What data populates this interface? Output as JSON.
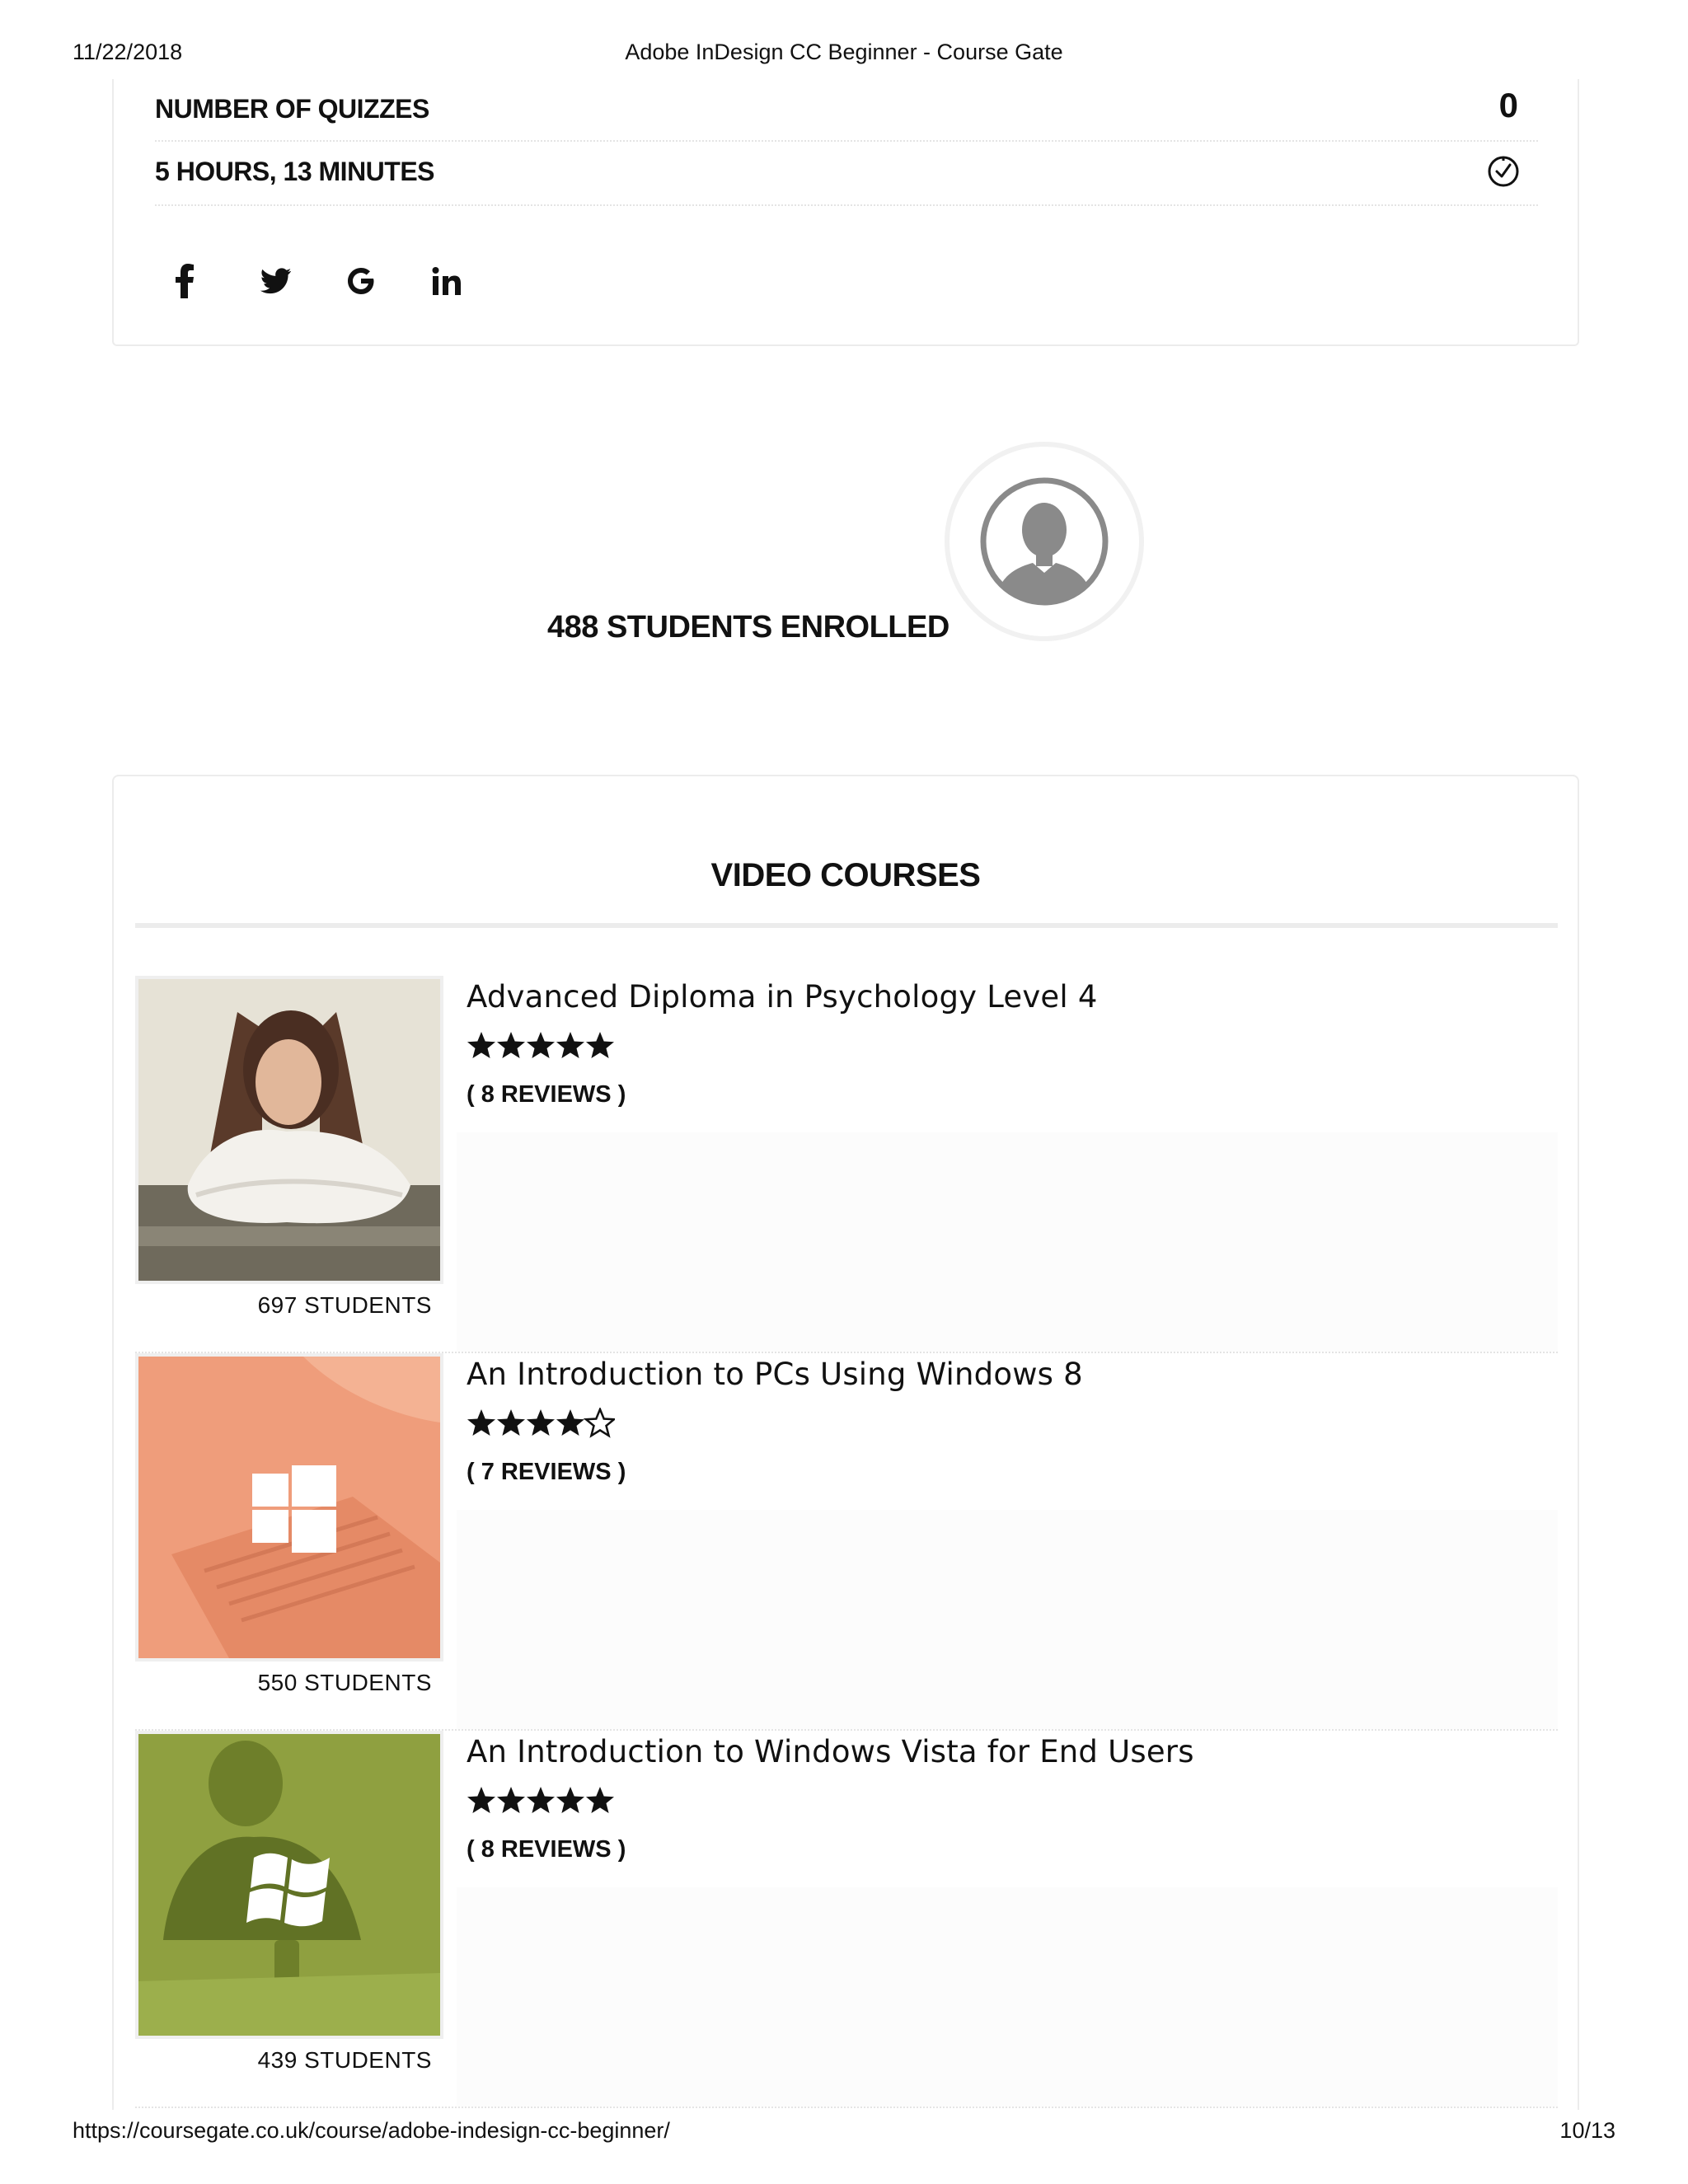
{
  "print_header": {
    "date": "11/22/2018",
    "title": "Adobe InDesign CC Beginner - Course Gate"
  },
  "print_footer": {
    "url": "https://coursegate.co.uk/course/adobe-indesign-cc-beginner/",
    "page": "10/13"
  },
  "meta": {
    "quizzes_label": "NUMBER OF QUIZZES",
    "quizzes_value": "0",
    "duration_label": "5 HOURS, 13 MINUTES",
    "duration_icon": "clock-check-icon",
    "social_icons": [
      "facebook-icon",
      "twitter-icon",
      "google-icon",
      "linkedin-icon"
    ]
  },
  "enrolled": {
    "text": "488 STUDENTS ENROLLED",
    "icon": "user-avatar-icon"
  },
  "video_courses": {
    "title": "VIDEO COURSES",
    "items": [
      {
        "name": "Advanced Diploma in Psychology Level 4",
        "rating": 5,
        "reviews": "( 8 REVIEWS )",
        "students": "697 STUDENTS",
        "thumb_color": "#d9d4c8",
        "thumb_icon": "person-photo-icon"
      },
      {
        "name": "An Introduction to PCs Using Windows 8",
        "rating": 4.5,
        "reviews": "( 7 REVIEWS )",
        "students": "550 STUDENTS",
        "thumb_color": "#ee9b79",
        "thumb_icon": "windows-8-logo-icon"
      },
      {
        "name": "An Introduction to Windows Vista for End Users",
        "rating": 5,
        "reviews": "( 8 REVIEWS )",
        "students": "439 STUDENTS",
        "thumb_color": "#8ea13f",
        "thumb_icon": "windows-flag-logo-icon"
      }
    ]
  }
}
